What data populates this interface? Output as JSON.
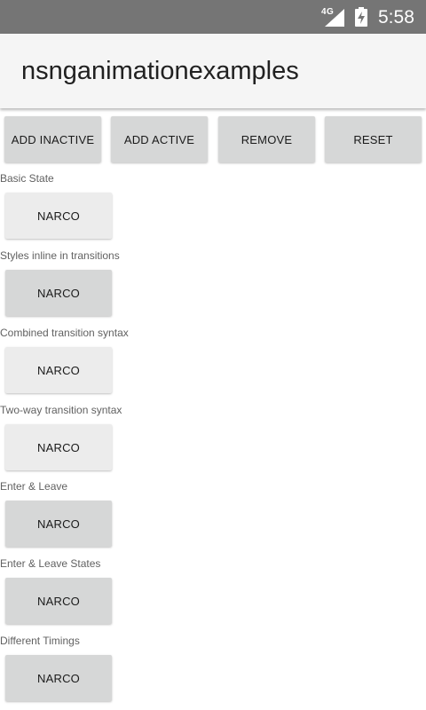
{
  "status_bar": {
    "network": "4G",
    "time": "5:58",
    "icons": [
      "signal-icon",
      "battery-charging-icon"
    ]
  },
  "action_bar": {
    "title": "nsnganimationexamples"
  },
  "toolbar": {
    "add_inactive": "ADD INACTIVE",
    "add_active": "ADD ACTIVE",
    "remove": "REMOVE",
    "reset": "RESET"
  },
  "sections": [
    {
      "label": "Basic State",
      "button": "NARCO"
    },
    {
      "label": "Styles inline in transitions",
      "button": "NARCO"
    },
    {
      "label": "Combined transition syntax",
      "button": "NARCO"
    },
    {
      "label": "Two-way transition syntax",
      "button": "NARCO"
    },
    {
      "label": "Enter & Leave",
      "button": "NARCO"
    },
    {
      "label": "Enter & Leave States",
      "button": "NARCO"
    },
    {
      "label": "Different Timings",
      "button": "NARCO"
    }
  ],
  "colors": {
    "status_bar": "#757575",
    "action_bar": "#f5f5f5",
    "button": "#d6d7d7",
    "button_light": "#ececec"
  }
}
